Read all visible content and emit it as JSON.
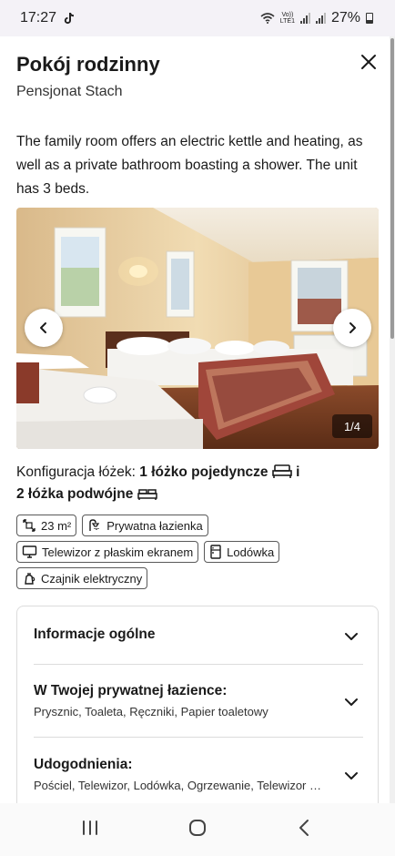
{
  "status_bar": {
    "time": "17:27",
    "app_icon": "tiktok-icon",
    "volte_top": "Vo))",
    "volte_bottom": "LTE1",
    "battery": "27%"
  },
  "header": {
    "title": "Pokój rodzinny",
    "subtitle": "Pensjonat Stach",
    "close_icon": "close-icon"
  },
  "description": "The family room offers an electric kettle and heating, as well as a private bathroom boasting a shower. The unit has 3 beds.",
  "gallery": {
    "counter": "1/4",
    "prev_icon": "chevron-left-icon",
    "next_icon": "chevron-right-icon"
  },
  "beds": {
    "label": "Konfiguracja łóżek:",
    "single": "1 łóżko pojedyncze",
    "connector": "i",
    "double": "2 łóżka podwójne"
  },
  "amenities": [
    {
      "label": "23 m²",
      "icon": "room-size-icon"
    },
    {
      "label": "Prywatna łazienka",
      "icon": "shower-icon"
    },
    {
      "label": "Telewizor z płaskim ekranem",
      "icon": "tv-icon"
    },
    {
      "label": "Lodówka",
      "icon": "fridge-icon"
    },
    {
      "label": "Czajnik elektryczny",
      "icon": "kettle-icon"
    }
  ],
  "sections": [
    {
      "title": "Informacje ogólne",
      "subtitle": ""
    },
    {
      "title": "W Twojej prywatnej łazience:",
      "subtitle": "Prysznic, Toaleta, Ręczniki, Papier toaletowy"
    },
    {
      "title": "Udogodnienia:",
      "subtitle": "Pościel, Telewizor, Lodówka, Ogrzewanie, Telewizor z płaskim ekranem"
    }
  ],
  "nav": {
    "recents": "recents-icon",
    "home": "home-icon",
    "back": "back-icon"
  }
}
